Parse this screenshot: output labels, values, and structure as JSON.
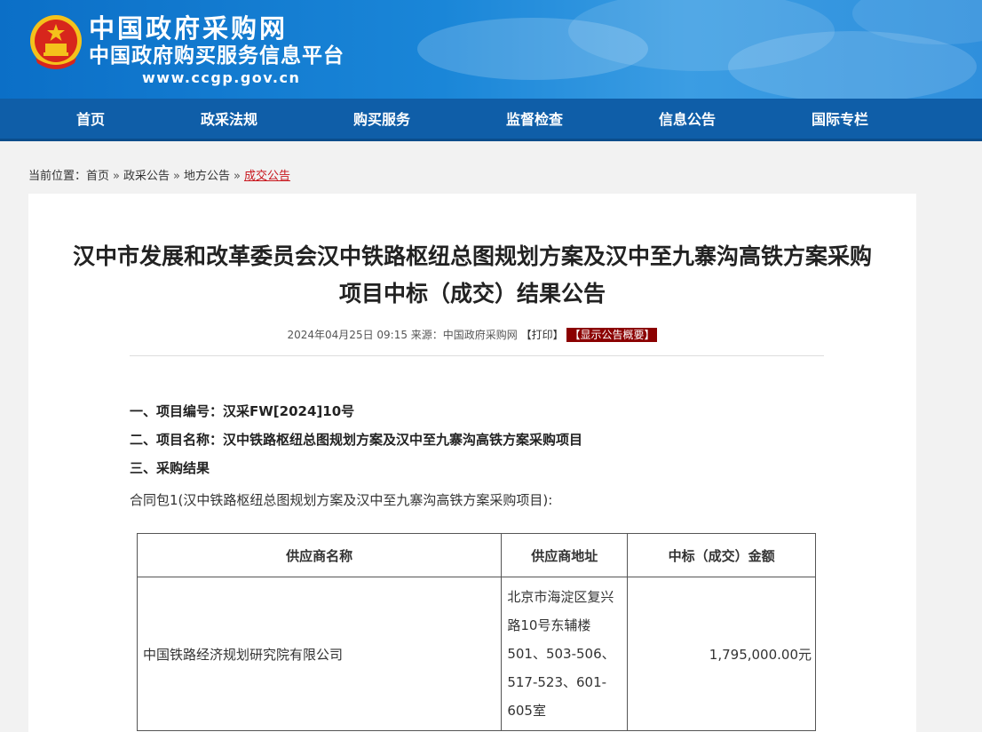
{
  "header": {
    "site_name": "中国政府采购网",
    "site_sub": "中国政府购买服务信息平台",
    "site_url": "www.ccgp.gov.cn"
  },
  "nav": {
    "items": [
      "首页",
      "政采法规",
      "购买服务",
      "监督检查",
      "信息公告",
      "国际专栏"
    ]
  },
  "breadcrumb": {
    "prefix": "当前位置：",
    "items": [
      "首页",
      "政采公告",
      "地方公告",
      "成交公告"
    ],
    "separator": "»"
  },
  "article": {
    "title_line1": "汉中市发展和改革委员会汉中铁路枢纽总图规划方案及汉中至九寨沟高铁方案采购",
    "title_line2": "项目中标（成交）结果公告",
    "meta_text": "2024年04月25日 09:15 来源：中国政府采购网",
    "print_label": "【打印】",
    "summary_label": "【显示公告概要】",
    "sections": [
      "一、项目编号：汉采FW[2024]10号",
      "二、项目名称：汉中铁路枢纽总图规划方案及汉中至九寨沟高铁方案采购项目",
      "三、采购结果"
    ],
    "package_label": "合同包1(汉中铁路枢纽总图规划方案及汉中至九寨沟高铁方案采购项目):",
    "table": {
      "headers": [
        "供应商名称",
        "供应商地址",
        "中标（成交）金额"
      ],
      "rows": [
        {
          "supplier": "中国铁路经济规划研究院有限公司",
          "address": "北京市海淀区复兴路10号东辅楼501、503-506、517-523、601-605室",
          "amount": "1,795,000.00元"
        }
      ]
    }
  },
  "colors": {
    "nav_bg": "#0f5ea8",
    "accent_red": "#c8161d",
    "summary_bg": "#8b0000"
  }
}
